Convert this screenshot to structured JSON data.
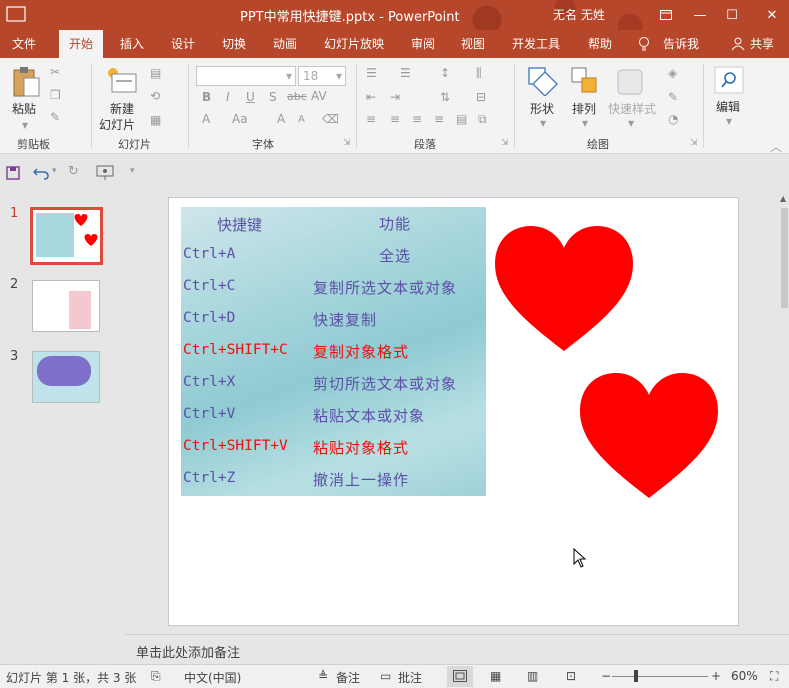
{
  "window": {
    "title": "PPT中常用快捷键.pptx  -  PowerPoint",
    "user": "无名 无姓",
    "minimize_glyph": "—",
    "restore_glyph": "❐",
    "maximize_glyph": "☐",
    "close_glyph": "✕"
  },
  "tabs": [
    "文件",
    "开始",
    "插入",
    "设计",
    "切换",
    "动画",
    "幻灯片放映",
    "审阅",
    "视图",
    "开发工具",
    "帮助",
    "告诉我",
    "共享"
  ],
  "ribbon": {
    "clipboard": {
      "paste": "粘贴",
      "label": "剪贴板"
    },
    "slides": {
      "new_slide_line1": "新建",
      "new_slide_line2": "幻灯片",
      "label": "幻灯片"
    },
    "font": {
      "size_value": "18",
      "label": "字体",
      "bold": "B",
      "italic": "I",
      "underline": "U",
      "strike": "S",
      "abc": "abc",
      "av": "AV",
      "fontcolor": "A",
      "aa": "Aa",
      "grow": "A",
      "shrink": "A"
    },
    "paragraph": {
      "label": "段落"
    },
    "drawing": {
      "shape": "形状",
      "arrange": "排列",
      "quickstyle": "快速样式",
      "label": "绘图"
    },
    "editing": {
      "label": "编辑"
    }
  },
  "thumbnails": [
    {
      "number": "1"
    },
    {
      "number": "2"
    },
    {
      "number": "3"
    }
  ],
  "slide": {
    "header": {
      "key": "快捷键",
      "func": "功能"
    },
    "rows": [
      {
        "key": "Ctrl+A",
        "func": "全选",
        "color": "#5b4fa6"
      },
      {
        "key": "Ctrl+C",
        "func": "复制所选文本或对象",
        "color": "#5b4fa6"
      },
      {
        "key": "Ctrl+D",
        "func": "快速复制",
        "color": "#5b4fa6"
      },
      {
        "key": "Ctrl+SHIFT+C",
        "func": "复制对象格式",
        "color": "#e8120c"
      },
      {
        "key": "Ctrl+X",
        "func": "剪切所选文本或对象",
        "color": "#5b4fa6"
      },
      {
        "key": "Ctrl+V",
        "func": "粘贴文本或对象",
        "color": "#5b4fa6"
      },
      {
        "key": "Ctrl+SHIFT+V",
        "func": "粘贴对象格式",
        "color": "#e8120c"
      },
      {
        "key": "Ctrl+Z",
        "func": "撤消上一操作",
        "color": "#5b4fa6"
      }
    ],
    "heart_color": "#ff0000"
  },
  "notes_placeholder": "单击此处添加备注",
  "status": {
    "slide_info": "幻灯片 第 1 张，共 3 张",
    "language": "中文(中国)",
    "notes": "备注",
    "comments": "批注",
    "zoom": "60%",
    "zoom_minus": "−",
    "zoom_plus": "+"
  },
  "colors": {
    "accent": "#b7472a"
  }
}
